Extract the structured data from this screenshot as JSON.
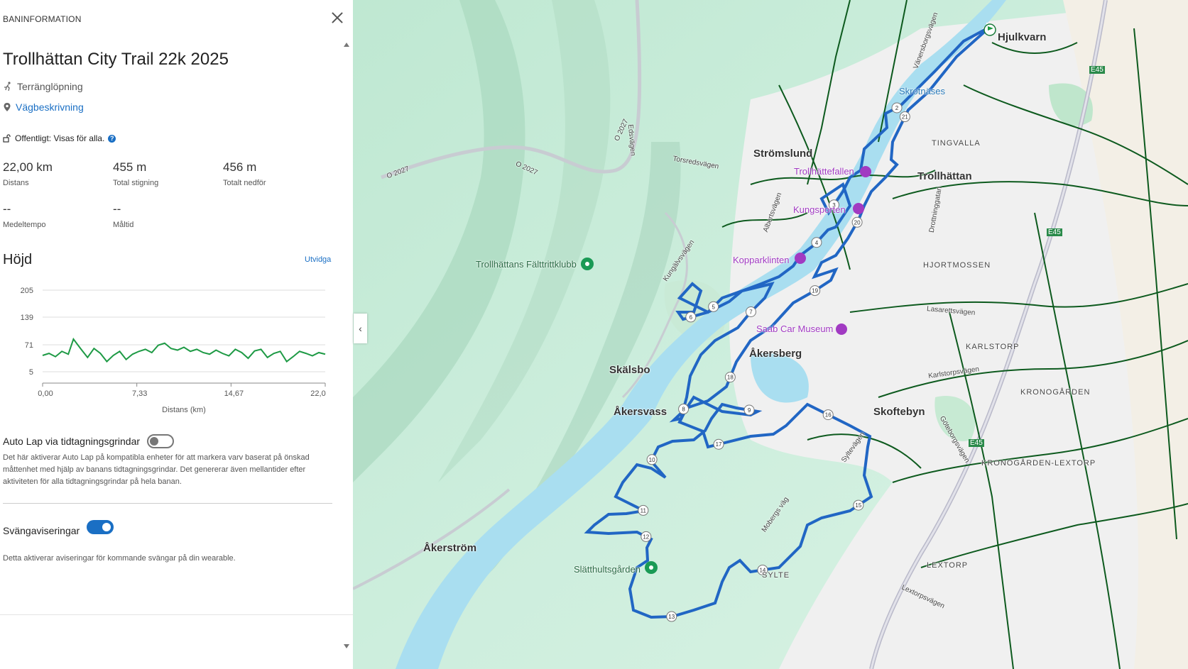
{
  "panel": {
    "header": "BANINFORMATION",
    "title": "Trollhättan City Trail 22k 2025",
    "activity_type": "Terränglöpning",
    "directions_label": "Vägbeskrivning",
    "visibility": "Offentligt: Visas för alla.",
    "help_icon": "?",
    "stats": [
      {
        "value": "22,00 km",
        "label": "Distans"
      },
      {
        "value": "455 m",
        "label": "Total stigning"
      },
      {
        "value": "456 m",
        "label": "Totalt nedför"
      },
      {
        "value": "--",
        "label": "Medeltempo"
      },
      {
        "value": "--",
        "label": "Måltid"
      }
    ],
    "elevation_title": "Höjd",
    "expand_label": "Utvidga",
    "auto_lap_label": "Auto Lap via tidtagningsgrindar",
    "auto_lap_enabled": false,
    "auto_lap_desc": "Det här aktiverar Auto Lap på kompatibla enheter för att markera varv baserat på önskad måttenhet med hjälp av banans tidtagningsgrindar. Det genererar även mellantider efter aktiviteten för alla tidtagningsgrindar på hela banan.",
    "turn_alerts_label": "Svängaviseringar",
    "turn_alerts_enabled": true,
    "turn_alerts_desc": "Detta aktiverar aviseringar för kommande svängar på din wearable."
  },
  "chart_data": {
    "type": "line",
    "title": "",
    "xlabel": "Distans (km)",
    "ylabel": "",
    "y_ticks": [
      "205",
      "139",
      "71",
      "5"
    ],
    "x_ticks": [
      "0,00",
      "7,33",
      "14,67",
      "22,0"
    ],
    "xlim": [
      0,
      22
    ],
    "ylim": [
      5,
      205
    ],
    "grid": true,
    "series": [
      {
        "color": "#1e9a45",
        "x": [
          0,
          0.5,
          1,
          1.5,
          2,
          2.4,
          3,
          3.5,
          4,
          4.5,
          5,
          5.5,
          6,
          6.5,
          7,
          7.5,
          8,
          8.5,
          9,
          9.5,
          10,
          10.5,
          11,
          11.5,
          12,
          12.5,
          13,
          13.5,
          14,
          14.5,
          15,
          15.5,
          16,
          16.5,
          17,
          17.5,
          18,
          18.5,
          19,
          19.5,
          20,
          20.5,
          21,
          21.5,
          22
        ],
        "y": [
          45,
          50,
          42,
          55,
          48,
          85,
          60,
          40,
          62,
          50,
          30,
          45,
          55,
          35,
          48,
          55,
          60,
          52,
          70,
          75,
          62,
          58,
          65,
          55,
          60,
          52,
          48,
          58,
          50,
          44,
          60,
          52,
          38,
          56,
          60,
          40,
          50,
          55,
          30,
          42,
          55,
          50,
          44,
          52,
          48
        ]
      }
    ]
  },
  "map": {
    "collapse_icon": "‹",
    "labels": {
      "hjulkvarn": "Hjulkvarn",
      "stromslund": "Strömslund",
      "trollhattan": "Trollhättan",
      "trollhattefallen": "Trollhättefallen",
      "kungsporten": "Kungsporten",
      "kopparklinten": "Kopparklinten",
      "faltrittklubb": "Trollhättans Fälttrittklubb",
      "saab": "Saab Car Museum",
      "akersberg": "Åkersberg",
      "skalsbo": "Skälsbo",
      "akersvass": "Åkersvass",
      "skoftebyn": "Skoftebyn",
      "akerstrom": "Åkerström",
      "slatthult": "Slätthultsgården",
      "krokstrand": "Skrotnäses",
      "tingvalla": "TINGVALLA",
      "hjortmossen": "HJORTMOSSEN",
      "karlstorp": "KARLSTORP",
      "kronogarden": "KRONOGÅRDEN",
      "kronogarden_lextorp": "KRONOGÅRDEN-LEXTORP",
      "lextorp": "LEXTORP",
      "sylte": "SYLTE",
      "road_o2027a": "O 2027",
      "road_o2027b": "O 2027",
      "road_o2027c": "O 2027",
      "road_edsvagen": "Edsvägen",
      "road_torsred": "Torsredsvägen",
      "road_kungalv": "Kungälvsvägen",
      "road_albertsv": "Albertsvägen",
      "road_vanersborg": "Vänersborgsvägen",
      "road_drottning": "Drottninggatan",
      "road_lasarett": "Lasarettsvägen",
      "road_karlstorp": "Karlstorpsvägen",
      "road_goteborg": "Göteborgsvägen",
      "road_mollbergs": "Mobergs väg",
      "road_sylte": "Syltevägen",
      "road_lextorps": "Lextorpsvägen",
      "road_e45a": "E45",
      "road_e45b": "E45",
      "road_e45c": "E45"
    },
    "markers": [
      "2",
      "3",
      "4",
      "5",
      "6",
      "7",
      "8",
      "9",
      "10",
      "11",
      "12",
      "13",
      "14",
      "15",
      "16",
      "17",
      "18",
      "19",
      "20",
      "21"
    ],
    "route_color": "#2166c4"
  }
}
